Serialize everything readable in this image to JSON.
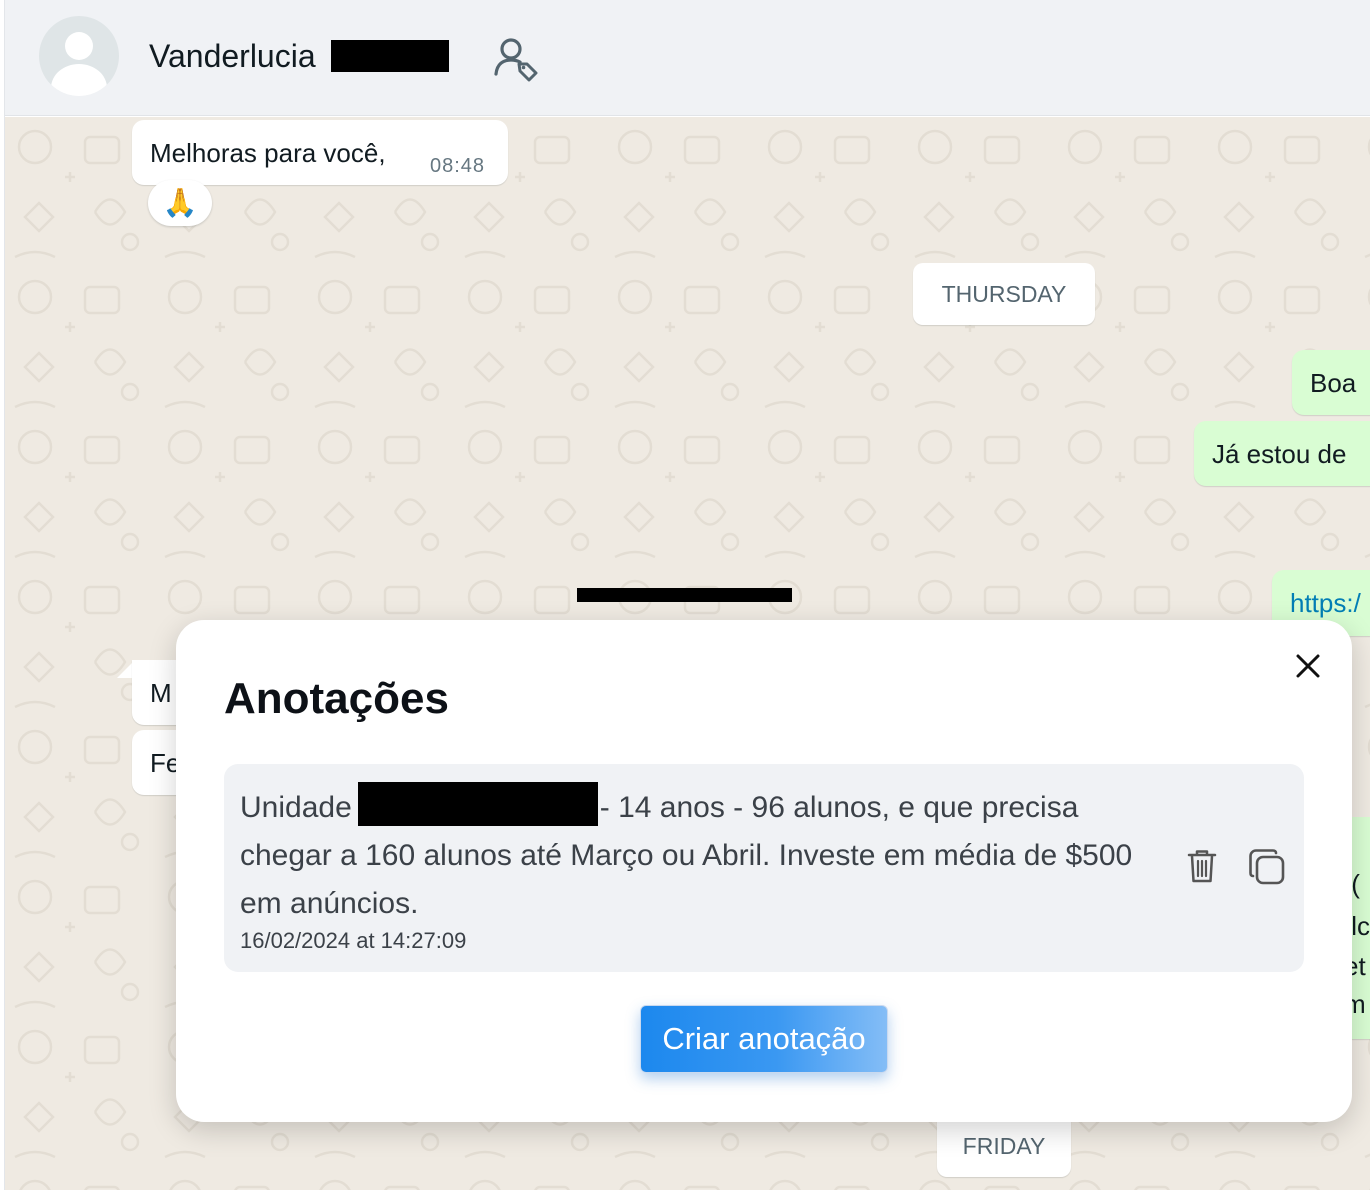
{
  "header": {
    "contact_name": "Vanderlucia",
    "contact_icon": "user-tag-icon",
    "avatar_icon": "default-avatar-icon"
  },
  "chat": {
    "messages": [
      {
        "direction": "incoming",
        "text": "Melhoras para você,",
        "time": "08:48",
        "reaction": "🙏"
      },
      {
        "direction": "outgoing",
        "text": "Boa"
      },
      {
        "direction": "outgoing",
        "text": "Já estou de"
      },
      {
        "direction": "outgoing",
        "text": "https:/",
        "is_link": true
      },
      {
        "direction": "incoming",
        "text": "M"
      },
      {
        "direction": "incoming",
        "text": "Fe"
      }
    ],
    "day_chips": [
      "THURSDAY",
      "FRIDAY"
    ],
    "partial_right_lines": [
      ":(",
      "ılc",
      "et",
      "m"
    ]
  },
  "modal": {
    "title": "Anotações",
    "close_icon": "close-icon",
    "note": {
      "text_before": "Unidade",
      "text_after": "- 14 anos - 96 alunos, e que precisa chegar a 160 alunos até Março ou Abril. Investe em média de $500 em anúncios.",
      "date": "16/02/2024 at 14:27:09",
      "delete_icon": "trash-icon",
      "copy_icon": "copy-icon"
    },
    "create_button": "Criar anotação"
  },
  "colors": {
    "chat_background": "#efeae2",
    "outgoing_bubble": "#d9fdd3",
    "header_background": "#f0f2f5",
    "primary_button": "#1c88ee",
    "link": "#027eb5"
  }
}
